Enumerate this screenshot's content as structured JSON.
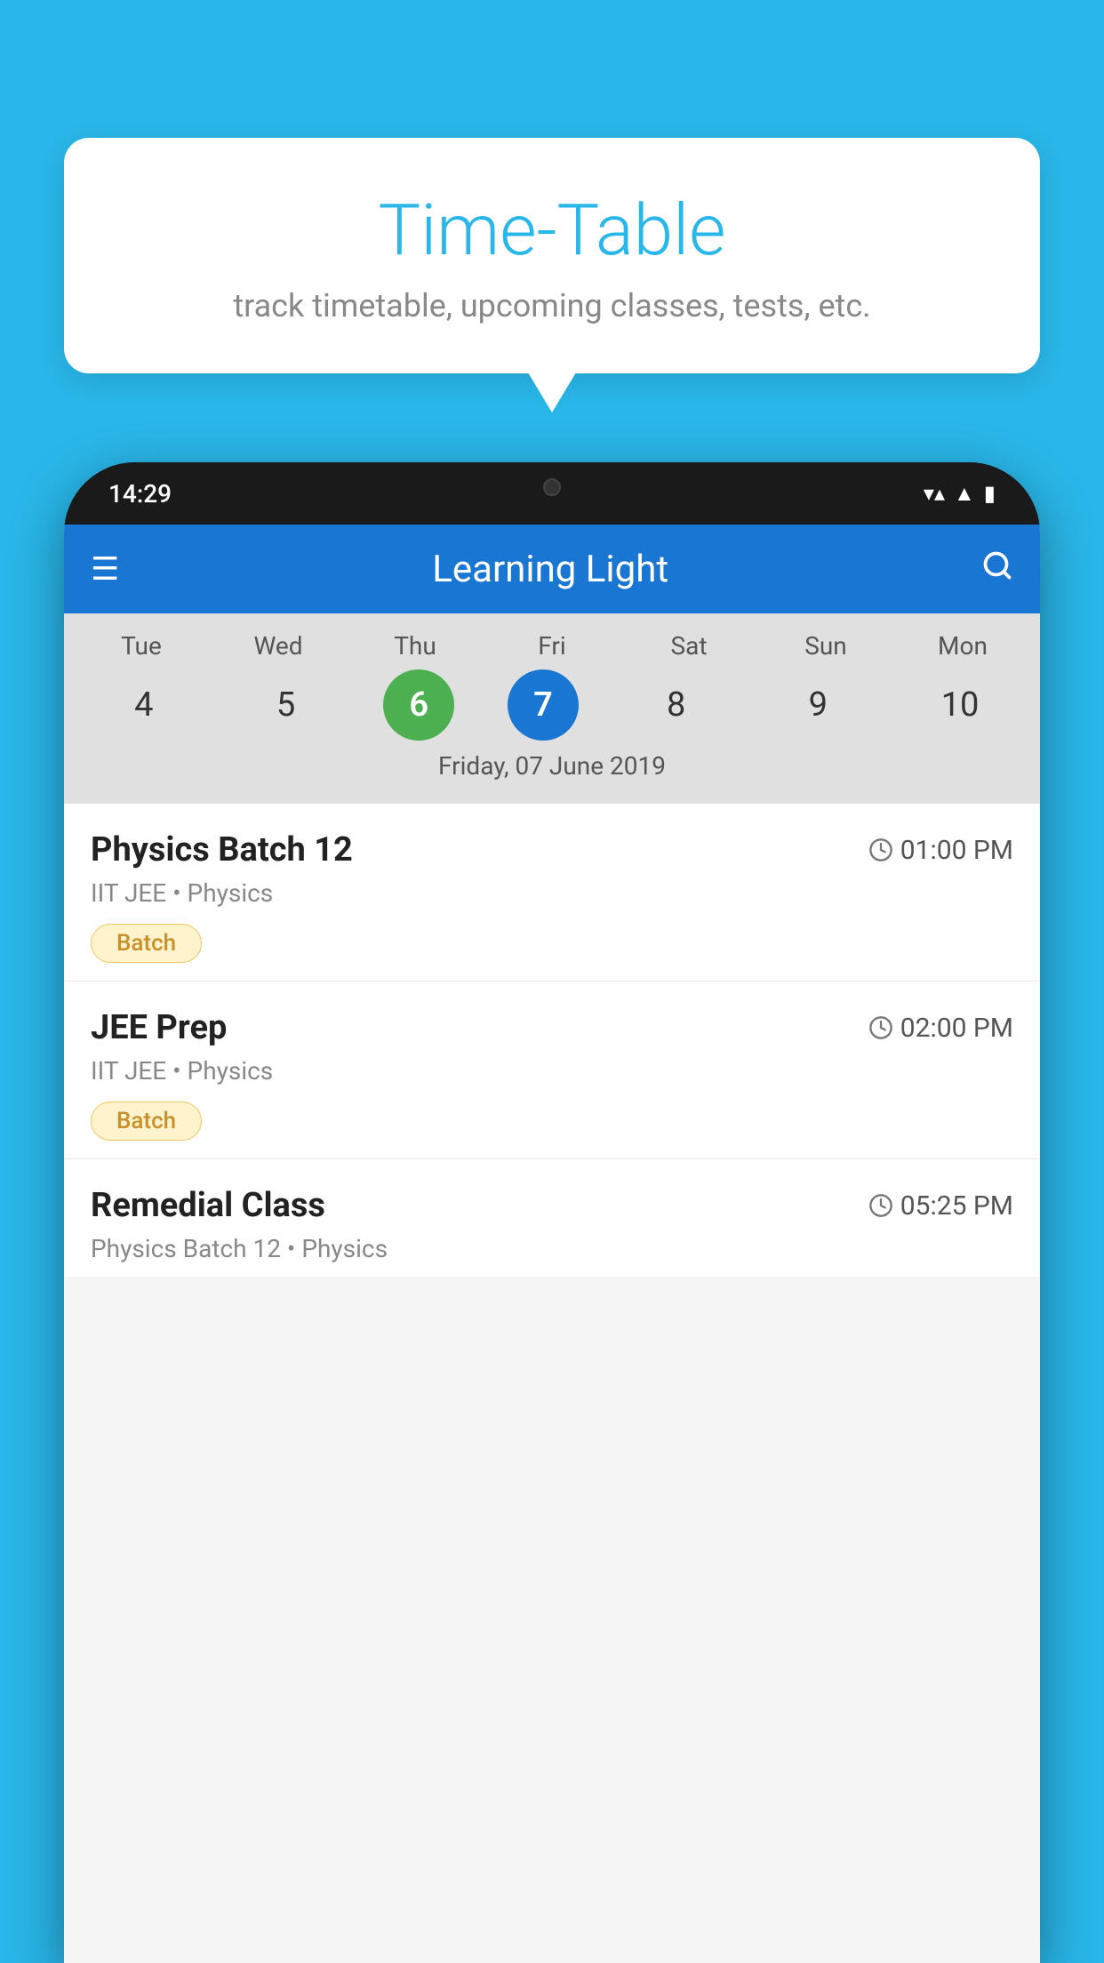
{
  "background_color": "#29b6e8",
  "tooltip": {
    "title": "Time-Table",
    "subtitle": "track timetable, upcoming classes, tests, etc."
  },
  "status_bar": {
    "time": "14:29",
    "wifi": "▼",
    "signal": "▲",
    "battery": "▮"
  },
  "app_bar": {
    "title": "Learning Light",
    "menu_icon": "☰",
    "search_icon": "🔍"
  },
  "calendar": {
    "days": [
      {
        "label": "Tue",
        "number": "4",
        "state": "normal"
      },
      {
        "label": "Wed",
        "number": "5",
        "state": "normal"
      },
      {
        "label": "Thu",
        "number": "6",
        "state": "today"
      },
      {
        "label": "Fri",
        "number": "7",
        "state": "selected"
      },
      {
        "label": "Sat",
        "number": "8",
        "state": "normal"
      },
      {
        "label": "Sun",
        "number": "9",
        "state": "normal"
      },
      {
        "label": "Mon",
        "number": "10",
        "state": "normal"
      }
    ],
    "selected_date_label": "Friday, 07 June 2019"
  },
  "schedule": {
    "items": [
      {
        "title": "Physics Batch 12",
        "time": "01:00 PM",
        "subtitle": "IIT JEE • Physics",
        "badge": "Batch"
      },
      {
        "title": "JEE Prep",
        "time": "02:00 PM",
        "subtitle": "IIT JEE • Physics",
        "badge": "Batch"
      },
      {
        "title": "Remedial Class",
        "time": "05:25 PM",
        "subtitle": "Physics Batch 12 • Physics",
        "badge": null
      }
    ]
  }
}
